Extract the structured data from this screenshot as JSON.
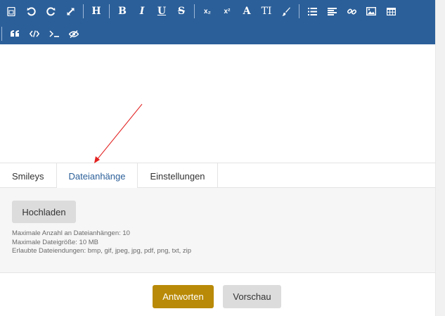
{
  "toolbar": {
    "row1": [
      {
        "icon": "source-icon"
      },
      {
        "icon": "undo-icon"
      },
      {
        "icon": "redo-icon"
      },
      {
        "icon": "fullscreen-icon"
      },
      {
        "separator": true
      },
      {
        "icon": "heading-icon",
        "label": "H"
      },
      {
        "separator": true
      },
      {
        "icon": "bold-icon",
        "label": "B"
      },
      {
        "icon": "italic-icon",
        "label": "I"
      },
      {
        "icon": "underline-icon",
        "label": "U"
      },
      {
        "icon": "strikethrough-icon",
        "label": "S"
      },
      {
        "separator": true
      },
      {
        "icon": "subscript-icon",
        "label": "x₂"
      },
      {
        "icon": "superscript-icon",
        "label": "x²"
      },
      {
        "icon": "font-size-icon",
        "label": "A"
      },
      {
        "icon": "font-family-icon",
        "label": "TI"
      },
      {
        "icon": "paint-brush-icon"
      },
      {
        "separator": true
      },
      {
        "icon": "list-icon"
      },
      {
        "icon": "align-icon"
      },
      {
        "icon": "link-icon"
      },
      {
        "icon": "image-icon"
      },
      {
        "icon": "table-icon"
      }
    ],
    "row2": [
      {
        "separator": true
      },
      {
        "icon": "quote-icon"
      },
      {
        "icon": "code-icon"
      },
      {
        "icon": "terminal-icon"
      },
      {
        "icon": "spoiler-icon"
      }
    ]
  },
  "tabs": [
    {
      "label": "Smileys",
      "active": false
    },
    {
      "label": "Dateianhänge",
      "active": true
    },
    {
      "label": "Einstellungen",
      "active": false
    }
  ],
  "panel": {
    "upload_label": "Hochladen",
    "info_lines": [
      "Maximale Anzahl an Dateianhängen: 10",
      "Maximale Dateigröße: 10 MB",
      "Erlaubte Dateiendungen: bmp, gif, jpeg, jpg, pdf, png, txt, zip"
    ]
  },
  "actions": {
    "reply_label": "Antworten",
    "preview_label": "Vorschau"
  },
  "colors": {
    "toolbar_bg": "#2b5f99",
    "accent_tab": "#2b5f99",
    "reply_bg": "#b98a07",
    "arrow": "#e32020"
  }
}
